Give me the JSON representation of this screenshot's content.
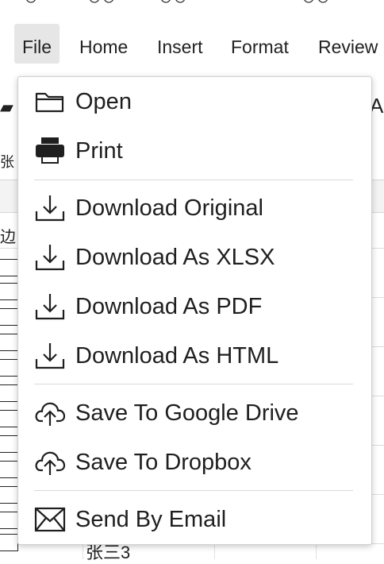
{
  "menubar": {
    "items": [
      {
        "label": "File",
        "active": true
      },
      {
        "label": "Home"
      },
      {
        "label": "Insert"
      },
      {
        "label": "Format"
      },
      {
        "label": "Review"
      }
    ]
  },
  "file_menu": {
    "open": "Open",
    "print": "Print",
    "download_original": "Download Original",
    "download_xlsx": "Download As XLSX",
    "download_pdf": "Download As PDF",
    "download_html": "Download As HTML",
    "save_google_drive": "Save To Google Drive",
    "save_dropbox": "Save To Dropbox",
    "send_email": "Send By Email"
  },
  "sheet": {
    "left_cell_1": "张",
    "left_cell_2": "边",
    "bottom_cell": "张三3"
  },
  "icons": {
    "open": "folder-icon",
    "print": "printer-icon",
    "download": "download-icon",
    "cloud": "cloud-upload-icon",
    "email": "envelope-icon"
  }
}
